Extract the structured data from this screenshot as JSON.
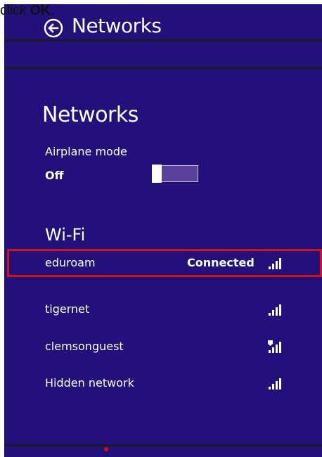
{
  "caption": {
    "prefix": "click ",
    "bold": "OK",
    "suffix": "."
  },
  "header": {
    "title": "Networks"
  },
  "section": {
    "title": "Networks"
  },
  "airplane": {
    "label": "Airplane mode",
    "state": "Off"
  },
  "wifi": {
    "title": "Wi-Fi",
    "networks": [
      {
        "name": "eduroam",
        "status": "Connected",
        "icon": "wifi-signal-icon",
        "selected": true
      },
      {
        "name": "tigernet",
        "status": "",
        "icon": "wifi-signal-icon",
        "selected": false
      },
      {
        "name": "clemsonguest",
        "status": "",
        "icon": "wifi-signal-shield-icon",
        "selected": false
      },
      {
        "name": "Hidden network",
        "status": "",
        "icon": "wifi-signal-icon",
        "selected": false
      }
    ]
  },
  "colors": {
    "panel": "#24107a",
    "highlight": "#d0101f",
    "toggle_track": "#5a3f9c"
  }
}
